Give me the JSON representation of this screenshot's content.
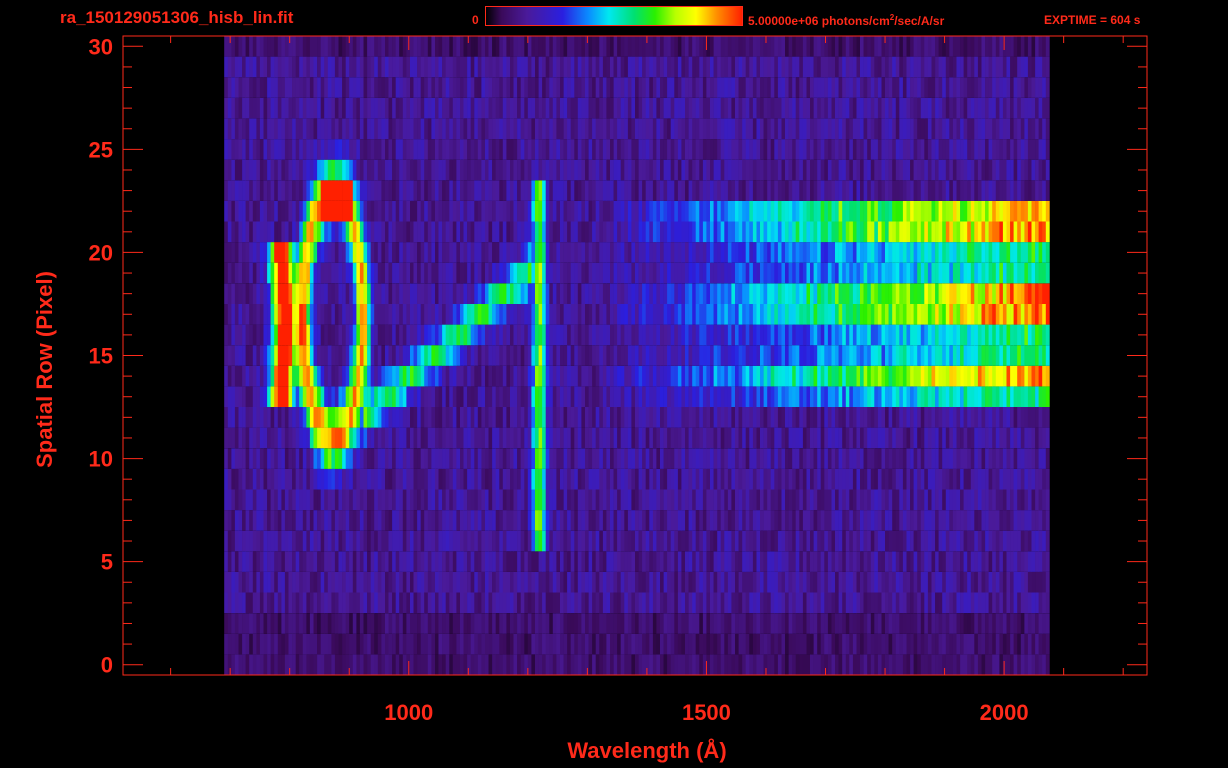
{
  "header": {
    "file_name": "ra_150129051306_hisb_lin.fit",
    "colorbar_min": "0",
    "colorbar_max_prefix": "5.00000e+06 photons/cm",
    "colorbar_max_sup": "2",
    "colorbar_max_suffix": "/sec/A/sr",
    "exptime": "EXPTIME = 604 s"
  },
  "colors": {
    "axis": "#ff2a1a",
    "background": "#000000"
  },
  "chart_data": {
    "type": "heatmap",
    "title": "ra_150129051306_hisb_lin.fit",
    "xlabel": "Wavelength (Å)",
    "ylabel": "Spatial Row (Pixel)",
    "xlim": [
      520,
      2240
    ],
    "ylim": [
      -0.5,
      30.5
    ],
    "x_ticks": [
      1000,
      1500,
      2000
    ],
    "y_ticks": [
      0,
      5,
      10,
      15,
      20,
      25,
      30
    ],
    "colorbar": {
      "min": 0,
      "max": 5000000,
      "units": "photons/cm2/sec/A/sr",
      "colormap": "rainbow"
    },
    "wavelength_range": [
      690,
      2070
    ],
    "features": [
      {
        "name": "arc-left-bright",
        "x": 790,
        "rows": [
          13,
          20
        ],
        "intensity": 1.0
      },
      {
        "name": "arc-ring",
        "x": [
          820,
          920
        ],
        "rows": [
          11,
          23
        ],
        "intensity": 0.75
      },
      {
        "name": "ring-top",
        "x": [
          850,
          900
        ],
        "rows": [
          22,
          23
        ],
        "intensity": 0.8
      },
      {
        "name": "diagonal-ramp",
        "x": [
          920,
          1200
        ],
        "rows": [
          12,
          19
        ],
        "intensity": 0.45
      },
      {
        "name": "line-1216",
        "x": 1216,
        "rows": [
          6,
          23
        ],
        "intensity": 0.55
      },
      {
        "name": "continuum-bands",
        "x": [
          1300,
          2060
        ],
        "rows": [
          13,
          22
        ],
        "intensity": 0.9
      }
    ],
    "noise_level": 0.18
  }
}
